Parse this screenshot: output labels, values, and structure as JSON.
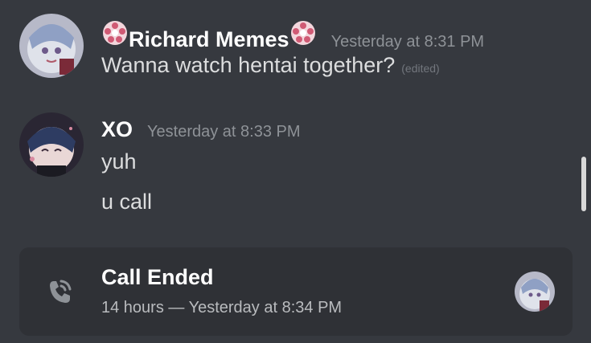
{
  "messages": [
    {
      "username": "Richard Memes",
      "timestamp": "Yesterday at 8:31 PM",
      "lines": [
        "Wanna watch hentai together?"
      ],
      "edited_label": "(edited)",
      "username_color": "#ffffff",
      "badge_icon": "sakura-badge-icon"
    },
    {
      "username": "XO",
      "timestamp": "Yesterday at 8:33 PM",
      "lines": [
        "yuh",
        "u call"
      ],
      "username_color": "#ffffff"
    }
  ],
  "call": {
    "title": "Call Ended",
    "meta": "14 hours — Yesterday at 8:34 PM",
    "icon": "phone-ended-icon"
  },
  "colors": {
    "background": "#36393f",
    "card": "#2f3136",
    "timestamp": "#8e9297",
    "text": "#dcddde"
  }
}
